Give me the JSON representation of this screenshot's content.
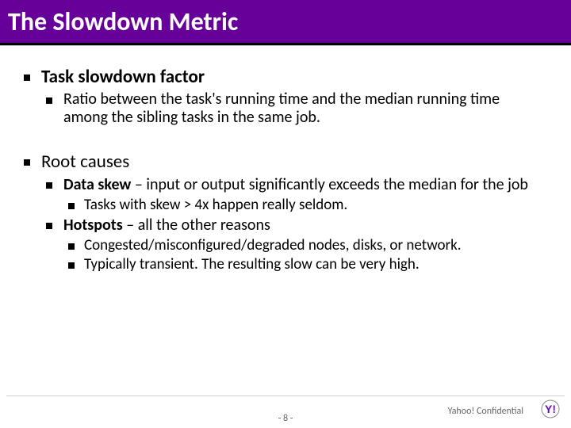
{
  "title": "The Slowdown Metric",
  "bullets": {
    "b1": "Task slowdown factor",
    "b1_1": "Ratio between the task's running time and the median running time among the sibling tasks in the same job.",
    "b2": "Root causes",
    "b2_1_b": "Data skew",
    "b2_1_t": " – input or output significantly exceeds the median for the job",
    "b2_1_1": "Tasks with skew > 4x happen really seldom.",
    "b2_2_b": "Hotspots",
    "b2_2_t": " – all the other reasons",
    "b2_2_1": "Congested/misconfigured/degraded nodes, disks, or network.",
    "b2_2_2": "Typically transient. The resulting slow can be very high."
  },
  "footer": {
    "page": "- 8 -",
    "confidential": "Yahoo! Confidential"
  }
}
